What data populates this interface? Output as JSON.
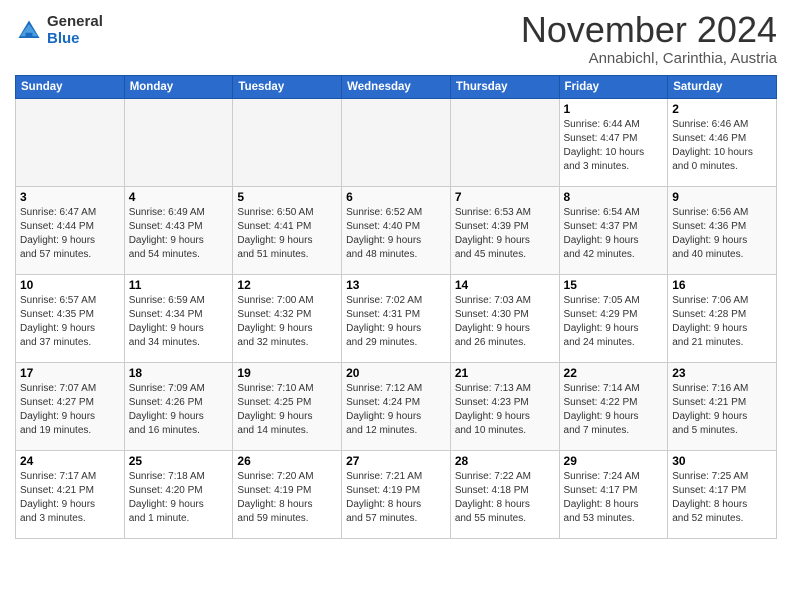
{
  "logo": {
    "general": "General",
    "blue": "Blue"
  },
  "title": "November 2024",
  "subtitle": "Annabichl, Carinthia, Austria",
  "weekdays": [
    "Sunday",
    "Monday",
    "Tuesday",
    "Wednesday",
    "Thursday",
    "Friday",
    "Saturday"
  ],
  "weeks": [
    [
      {
        "day": "",
        "info": ""
      },
      {
        "day": "",
        "info": ""
      },
      {
        "day": "",
        "info": ""
      },
      {
        "day": "",
        "info": ""
      },
      {
        "day": "",
        "info": ""
      },
      {
        "day": "1",
        "info": "Sunrise: 6:44 AM\nSunset: 4:47 PM\nDaylight: 10 hours\nand 3 minutes."
      },
      {
        "day": "2",
        "info": "Sunrise: 6:46 AM\nSunset: 4:46 PM\nDaylight: 10 hours\nand 0 minutes."
      }
    ],
    [
      {
        "day": "3",
        "info": "Sunrise: 6:47 AM\nSunset: 4:44 PM\nDaylight: 9 hours\nand 57 minutes."
      },
      {
        "day": "4",
        "info": "Sunrise: 6:49 AM\nSunset: 4:43 PM\nDaylight: 9 hours\nand 54 minutes."
      },
      {
        "day": "5",
        "info": "Sunrise: 6:50 AM\nSunset: 4:41 PM\nDaylight: 9 hours\nand 51 minutes."
      },
      {
        "day": "6",
        "info": "Sunrise: 6:52 AM\nSunset: 4:40 PM\nDaylight: 9 hours\nand 48 minutes."
      },
      {
        "day": "7",
        "info": "Sunrise: 6:53 AM\nSunset: 4:39 PM\nDaylight: 9 hours\nand 45 minutes."
      },
      {
        "day": "8",
        "info": "Sunrise: 6:54 AM\nSunset: 4:37 PM\nDaylight: 9 hours\nand 42 minutes."
      },
      {
        "day": "9",
        "info": "Sunrise: 6:56 AM\nSunset: 4:36 PM\nDaylight: 9 hours\nand 40 minutes."
      }
    ],
    [
      {
        "day": "10",
        "info": "Sunrise: 6:57 AM\nSunset: 4:35 PM\nDaylight: 9 hours\nand 37 minutes."
      },
      {
        "day": "11",
        "info": "Sunrise: 6:59 AM\nSunset: 4:34 PM\nDaylight: 9 hours\nand 34 minutes."
      },
      {
        "day": "12",
        "info": "Sunrise: 7:00 AM\nSunset: 4:32 PM\nDaylight: 9 hours\nand 32 minutes."
      },
      {
        "day": "13",
        "info": "Sunrise: 7:02 AM\nSunset: 4:31 PM\nDaylight: 9 hours\nand 29 minutes."
      },
      {
        "day": "14",
        "info": "Sunrise: 7:03 AM\nSunset: 4:30 PM\nDaylight: 9 hours\nand 26 minutes."
      },
      {
        "day": "15",
        "info": "Sunrise: 7:05 AM\nSunset: 4:29 PM\nDaylight: 9 hours\nand 24 minutes."
      },
      {
        "day": "16",
        "info": "Sunrise: 7:06 AM\nSunset: 4:28 PM\nDaylight: 9 hours\nand 21 minutes."
      }
    ],
    [
      {
        "day": "17",
        "info": "Sunrise: 7:07 AM\nSunset: 4:27 PM\nDaylight: 9 hours\nand 19 minutes."
      },
      {
        "day": "18",
        "info": "Sunrise: 7:09 AM\nSunset: 4:26 PM\nDaylight: 9 hours\nand 16 minutes."
      },
      {
        "day": "19",
        "info": "Sunrise: 7:10 AM\nSunset: 4:25 PM\nDaylight: 9 hours\nand 14 minutes."
      },
      {
        "day": "20",
        "info": "Sunrise: 7:12 AM\nSunset: 4:24 PM\nDaylight: 9 hours\nand 12 minutes."
      },
      {
        "day": "21",
        "info": "Sunrise: 7:13 AM\nSunset: 4:23 PM\nDaylight: 9 hours\nand 10 minutes."
      },
      {
        "day": "22",
        "info": "Sunrise: 7:14 AM\nSunset: 4:22 PM\nDaylight: 9 hours\nand 7 minutes."
      },
      {
        "day": "23",
        "info": "Sunrise: 7:16 AM\nSunset: 4:21 PM\nDaylight: 9 hours\nand 5 minutes."
      }
    ],
    [
      {
        "day": "24",
        "info": "Sunrise: 7:17 AM\nSunset: 4:21 PM\nDaylight: 9 hours\nand 3 minutes."
      },
      {
        "day": "25",
        "info": "Sunrise: 7:18 AM\nSunset: 4:20 PM\nDaylight: 9 hours\nand 1 minute."
      },
      {
        "day": "26",
        "info": "Sunrise: 7:20 AM\nSunset: 4:19 PM\nDaylight: 8 hours\nand 59 minutes."
      },
      {
        "day": "27",
        "info": "Sunrise: 7:21 AM\nSunset: 4:19 PM\nDaylight: 8 hours\nand 57 minutes."
      },
      {
        "day": "28",
        "info": "Sunrise: 7:22 AM\nSunset: 4:18 PM\nDaylight: 8 hours\nand 55 minutes."
      },
      {
        "day": "29",
        "info": "Sunrise: 7:24 AM\nSunset: 4:17 PM\nDaylight: 8 hours\nand 53 minutes."
      },
      {
        "day": "30",
        "info": "Sunrise: 7:25 AM\nSunset: 4:17 PM\nDaylight: 8 hours\nand 52 minutes."
      }
    ]
  ]
}
